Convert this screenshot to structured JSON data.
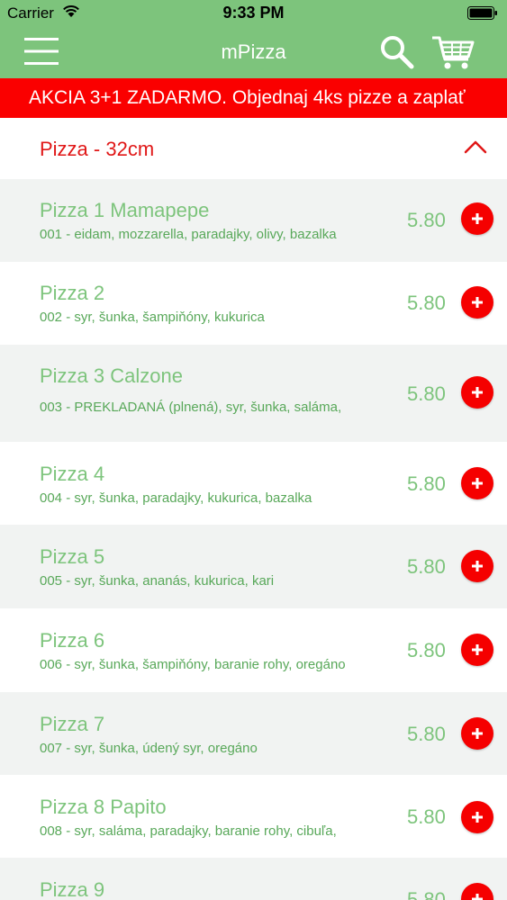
{
  "status_bar": {
    "carrier": "Carrier",
    "time": "9:33 PM"
  },
  "header": {
    "title": "mPizza"
  },
  "promo": {
    "text": "AKCIA 3+1 ZADARMO. Objednaj 4ks pizze a zaplať"
  },
  "section": {
    "label": "Pizza - 32cm"
  },
  "items": [
    {
      "name": "Pizza 1 Mamapepe",
      "desc": "001 - eidam, mozzarella, paradajky, olivy, bazalka",
      "price": "5.80"
    },
    {
      "name": "Pizza 2",
      "desc": "002 - syr, šunka, šampiňóny, kukurica",
      "price": "5.80"
    },
    {
      "name": "Pizza 3 Calzone",
      "desc": "003 - PREKLADANÁ (plnená), syr, šunka, saláma,",
      "price": "5.80"
    },
    {
      "name": "Pizza 4",
      "desc": "004 - syr, šunka, paradajky, kukurica, bazalka",
      "price": "5.80"
    },
    {
      "name": "Pizza 5",
      "desc": "005 - syr, šunka, ananás, kukurica, kari",
      "price": "5.80"
    },
    {
      "name": "Pizza 6",
      "desc": "006 - syr, šunka, šampiňóny, baranie rohy, oregáno",
      "price": "5.80"
    },
    {
      "name": "Pizza 7",
      "desc": "007 - syr, šunka, údený syr, oregáno",
      "price": "5.80"
    },
    {
      "name": "Pizza 8 Papito",
      "desc": "008 - syr, saláma, paradajky, baranie rohy, cibuľa,",
      "price": "5.80"
    },
    {
      "name": "Pizza 9",
      "desc": "",
      "price": "5.80"
    }
  ],
  "colors": {
    "accent_green": "#7dc47c",
    "red": "#fa0000"
  }
}
